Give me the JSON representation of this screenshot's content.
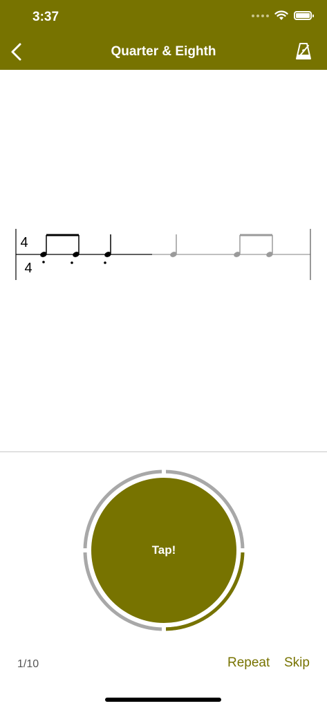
{
  "status_bar": {
    "time": "3:37"
  },
  "header": {
    "title": "Quarter & Eighth"
  },
  "notation": {
    "time_signature": {
      "top": "4",
      "bottom": "4"
    }
  },
  "tap_button": {
    "label": "Tap!"
  },
  "footer": {
    "counter": "1/10",
    "repeat_label": "Repeat",
    "skip_label": "Skip"
  },
  "colors": {
    "accent": "#777300",
    "ring_track": "#a8a8a8"
  }
}
